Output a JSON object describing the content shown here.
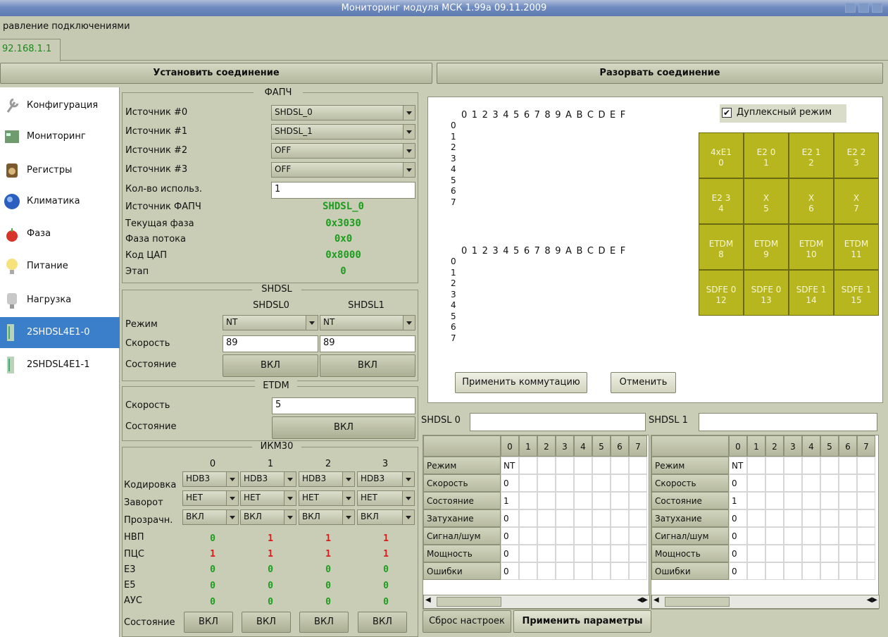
{
  "window": {
    "title": "Мониторинг модуля МСК 1.99а 09.11.2009"
  },
  "menu": {
    "label": "равление подключениями"
  },
  "tab": {
    "label": "92.168.1.1"
  },
  "toolbar": {
    "connect": "Установить соединение",
    "disconnect": "Разорвать соединение"
  },
  "sidebar": {
    "items": [
      {
        "label": "Конфигурация",
        "icon": "wrench-icon"
      },
      {
        "label": "Мониторинг",
        "icon": "board-icon"
      },
      {
        "label": "Регистры",
        "icon": "speaker-icon"
      },
      {
        "label": "Климатика",
        "icon": "globe-icon"
      },
      {
        "label": "Фаза",
        "icon": "apple-icon"
      },
      {
        "label": "Питание",
        "icon": "bulb-icon"
      },
      {
        "label": "Нагрузка",
        "icon": "gauge-icon"
      },
      {
        "label": "2SHDSL4E1-0",
        "icon": "board-icon"
      },
      {
        "label": "2SHDSL4E1-1",
        "icon": "board-icon"
      }
    ]
  },
  "fapch": {
    "legend": "ФАПЧ",
    "src0_label": "Источник #0",
    "src0": "SHDSL_0",
    "src1_label": "Источник #1",
    "src1": "SHDSL_1",
    "src2_label": "Источник #2",
    "src2": "OFF",
    "src3_label": "Источник #3",
    "src3": "OFF",
    "count_label": "Кол-во использ.",
    "count": "1",
    "source_label": "Источник ФАПЧ",
    "source": "SHDSL_0",
    "phase_label": "Текущая фаза",
    "phase": "0x3030",
    "flow_label": "Фаза потока",
    "flow": "0x0",
    "dac_label": "Код ЦАП",
    "dac": "0x8000",
    "stage_label": "Этап",
    "stage": "0"
  },
  "shdsl": {
    "legend": "SHDSL",
    "col0": "SHDSL0",
    "col1": "SHDSL1",
    "mode_label": "Режим",
    "mode0": "NT",
    "mode1": "NT",
    "speed_label": "Скорость",
    "speed0": "89",
    "speed1": "89",
    "state_label": "Состояние",
    "state0": "ВКЛ",
    "state1": "ВКЛ"
  },
  "etdm": {
    "legend": "ETDM",
    "speed_label": "Скорость",
    "speed": "5",
    "state_label": "Состояние",
    "state": "ВКЛ"
  },
  "ikm": {
    "legend": "ИКМ30",
    "cols": [
      "0",
      "1",
      "2",
      "3"
    ],
    "coding_label": "Кодировка",
    "coding": [
      "HDB3",
      "HDB3",
      "HDB3",
      "HDB3"
    ],
    "loop_label": "Заворот",
    "loop": [
      "НЕТ",
      "НЕТ",
      "НЕТ",
      "НЕТ"
    ],
    "transp_label": "Прозрачн.",
    "transp": [
      "ВКЛ",
      "ВКЛ",
      "ВКЛ",
      "ВКЛ"
    ],
    "nvp_label": "НВП",
    "nvp": [
      "0",
      "1",
      "1",
      "1"
    ],
    "pcs_label": "ПЦС",
    "pcs": [
      "1",
      "1",
      "1",
      "1"
    ],
    "e3_label": "E3",
    "e3": [
      "0",
      "0",
      "0",
      "0"
    ],
    "e5_label": "E5",
    "e5": [
      "0",
      "0",
      "0",
      "0"
    ],
    "ays_label": "АУС",
    "ays": [
      "0",
      "0",
      "0",
      "0"
    ],
    "state_label": "Состояние",
    "state": [
      "ВКЛ",
      "ВКЛ",
      "ВКЛ",
      "ВКЛ"
    ]
  },
  "matrix": {
    "header": "0 1 2 3 4 5 6 7 8 9 A B C D E F",
    "rows": [
      "0",
      "1",
      "2",
      "3",
      "4",
      "5",
      "6",
      "7"
    ],
    "duplex_label": "Дуплексный режим",
    "duplex_checked": true,
    "apply": "Применить коммутацию",
    "cancel": "Отменить",
    "cells": [
      {
        "name": "4xE1",
        "num": "0"
      },
      {
        "name": "E2 0",
        "num": "1"
      },
      {
        "name": "E2 1",
        "num": "2"
      },
      {
        "name": "E2 2",
        "num": "3"
      },
      {
        "name": "E2 3",
        "num": "4"
      },
      {
        "name": "X",
        "num": "5"
      },
      {
        "name": "X",
        "num": "6"
      },
      {
        "name": "X",
        "num": "7"
      },
      {
        "name": "ETDM",
        "num": "8"
      },
      {
        "name": "ETDM",
        "num": "9"
      },
      {
        "name": "ETDM",
        "num": "10"
      },
      {
        "name": "ETDM",
        "num": "11"
      },
      {
        "name": "SDFE 0",
        "num": "12"
      },
      {
        "name": "SDFE 0",
        "num": "13"
      },
      {
        "name": "SDFE 1",
        "num": "14"
      },
      {
        "name": "SDFE 1",
        "num": "15"
      }
    ],
    "cell_color": "#b7b61e"
  },
  "tables": [
    {
      "label": "SHDSL 0",
      "cols": [
        "0",
        "1",
        "2",
        "3",
        "4",
        "5",
        "6",
        "7"
      ],
      "rows": [
        {
          "name": "Режим",
          "value": "NT"
        },
        {
          "name": "Скорость",
          "value": "0"
        },
        {
          "name": "Состояние",
          "value": "1"
        },
        {
          "name": "Затухание",
          "value": "0"
        },
        {
          "name": "Сигнал/шум",
          "value": "0"
        },
        {
          "name": "Мощность",
          "value": "0"
        },
        {
          "name": "Ошибки",
          "value": "0"
        }
      ]
    },
    {
      "label": "SHDSL 1",
      "cols": [
        "0",
        "1",
        "2",
        "3",
        "4",
        "5",
        "6",
        "7"
      ],
      "rows": [
        {
          "name": "Режим",
          "value": "NT"
        },
        {
          "name": "Скорость",
          "value": "0"
        },
        {
          "name": "Состояние",
          "value": "1"
        },
        {
          "name": "Затухание",
          "value": "0"
        },
        {
          "name": "Сигнал/шум",
          "value": "0"
        },
        {
          "name": "Мощность",
          "value": "0"
        },
        {
          "name": "Ошибки",
          "value": "0"
        }
      ]
    }
  ],
  "bottom": {
    "reset": "Сброс настроек",
    "apply": "Применить параметры"
  },
  "colors": {
    "accent_green": "#1e9c1e",
    "alert_red": "#d61d1d",
    "selected_blue": "#3b7fcb"
  }
}
